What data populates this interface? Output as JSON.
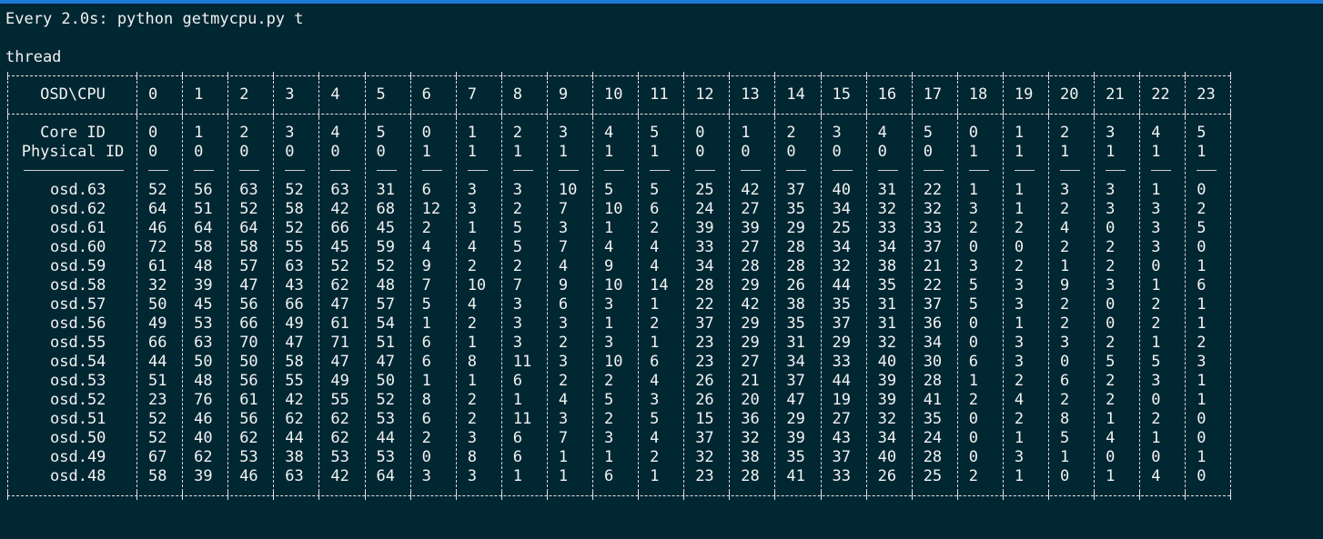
{
  "command_line": "Every 2.0s: python getmycpu.py t",
  "section_label": "thread",
  "table": {
    "corner_header": "OSD\\CPU",
    "cpu_columns": [
      "0",
      "1",
      "2",
      "3",
      "4",
      "5",
      "6",
      "7",
      "8",
      "9",
      "10",
      "11",
      "12",
      "13",
      "14",
      "15",
      "16",
      "17",
      "18",
      "19",
      "20",
      "21",
      "22",
      "23"
    ],
    "core_id_label": "Core ID",
    "core_ids": [
      "0",
      "1",
      "2",
      "3",
      "4",
      "5",
      "0",
      "1",
      "2",
      "3",
      "4",
      "5",
      "0",
      "1",
      "2",
      "3",
      "4",
      "5",
      "0",
      "1",
      "2",
      "3",
      "4",
      "5"
    ],
    "physical_id_label": "Physical ID",
    "physical_ids": [
      "0",
      "0",
      "0",
      "0",
      "0",
      "0",
      "1",
      "1",
      "1",
      "1",
      "1",
      "1",
      "0",
      "0",
      "0",
      "0",
      "0",
      "0",
      "1",
      "1",
      "1",
      "1",
      "1",
      "1"
    ],
    "rows": [
      {
        "osd": "osd.63",
        "values": [
          "52",
          "56",
          "63",
          "52",
          "63",
          "31",
          "6",
          "3",
          "3",
          "10",
          "5",
          "5",
          "25",
          "42",
          "37",
          "40",
          "31",
          "22",
          "1",
          "1",
          "3",
          "3",
          "1",
          "0"
        ]
      },
      {
        "osd": "osd.62",
        "values": [
          "64",
          "51",
          "52",
          "58",
          "42",
          "68",
          "12",
          "3",
          "2",
          "7",
          "10",
          "6",
          "24",
          "27",
          "35",
          "34",
          "32",
          "32",
          "3",
          "1",
          "2",
          "3",
          "3",
          "2"
        ]
      },
      {
        "osd": "osd.61",
        "values": [
          "46",
          "64",
          "64",
          "52",
          "66",
          "45",
          "2",
          "1",
          "5",
          "3",
          "1",
          "2",
          "39",
          "39",
          "29",
          "25",
          "33",
          "33",
          "2",
          "2",
          "4",
          "0",
          "3",
          "5"
        ]
      },
      {
        "osd": "osd.60",
        "values": [
          "72",
          "58",
          "58",
          "55",
          "45",
          "59",
          "4",
          "4",
          "5",
          "7",
          "4",
          "4",
          "33",
          "27",
          "28",
          "34",
          "34",
          "37",
          "0",
          "0",
          "2",
          "2",
          "3",
          "0"
        ]
      },
      {
        "osd": "osd.59",
        "values": [
          "61",
          "48",
          "57",
          "63",
          "52",
          "52",
          "9",
          "2",
          "2",
          "4",
          "9",
          "4",
          "34",
          "28",
          "28",
          "32",
          "38",
          "21",
          "3",
          "2",
          "1",
          "2",
          "0",
          "1"
        ]
      },
      {
        "osd": "osd.58",
        "values": [
          "32",
          "39",
          "47",
          "43",
          "62",
          "48",
          "7",
          "10",
          "7",
          "9",
          "10",
          "14",
          "28",
          "29",
          "26",
          "44",
          "35",
          "22",
          "5",
          "3",
          "9",
          "3",
          "1",
          "6"
        ]
      },
      {
        "osd": "osd.57",
        "values": [
          "50",
          "45",
          "56",
          "66",
          "47",
          "57",
          "5",
          "4",
          "3",
          "6",
          "3",
          "1",
          "22",
          "42",
          "38",
          "35",
          "31",
          "37",
          "5",
          "3",
          "2",
          "0",
          "2",
          "1"
        ]
      },
      {
        "osd": "osd.56",
        "values": [
          "49",
          "53",
          "66",
          "49",
          "61",
          "54",
          "1",
          "2",
          "3",
          "3",
          "1",
          "2",
          "37",
          "29",
          "35",
          "37",
          "31",
          "36",
          "0",
          "1",
          "2",
          "0",
          "2",
          "1"
        ]
      },
      {
        "osd": "osd.55",
        "values": [
          "66",
          "63",
          "70",
          "47",
          "71",
          "51",
          "6",
          "1",
          "3",
          "2",
          "3",
          "1",
          "23",
          "29",
          "31",
          "29",
          "32",
          "34",
          "0",
          "3",
          "3",
          "2",
          "1",
          "2"
        ]
      },
      {
        "osd": "osd.54",
        "values": [
          "44",
          "50",
          "50",
          "58",
          "47",
          "47",
          "6",
          "8",
          "11",
          "3",
          "10",
          "6",
          "23",
          "27",
          "34",
          "33",
          "40",
          "30",
          "6",
          "3",
          "0",
          "5",
          "5",
          "3"
        ]
      },
      {
        "osd": "osd.53",
        "values": [
          "51",
          "48",
          "56",
          "55",
          "49",
          "50",
          "1",
          "1",
          "6",
          "2",
          "2",
          "4",
          "26",
          "21",
          "37",
          "44",
          "39",
          "28",
          "1",
          "2",
          "6",
          "2",
          "3",
          "1"
        ]
      },
      {
        "osd": "osd.52",
        "values": [
          "23",
          "76",
          "61",
          "42",
          "55",
          "52",
          "8",
          "2",
          "1",
          "4",
          "5",
          "3",
          "26",
          "20",
          "47",
          "19",
          "39",
          "41",
          "2",
          "4",
          "2",
          "2",
          "0",
          "1"
        ]
      },
      {
        "osd": "osd.51",
        "values": [
          "52",
          "46",
          "56",
          "62",
          "62",
          "53",
          "6",
          "2",
          "11",
          "3",
          "2",
          "5",
          "15",
          "36",
          "29",
          "27",
          "32",
          "35",
          "0",
          "2",
          "8",
          "1",
          "2",
          "0"
        ]
      },
      {
        "osd": "osd.50",
        "values": [
          "52",
          "40",
          "62",
          "44",
          "62",
          "44",
          "2",
          "3",
          "6",
          "7",
          "3",
          "4",
          "37",
          "32",
          "39",
          "43",
          "34",
          "24",
          "0",
          "1",
          "5",
          "4",
          "1",
          "0"
        ]
      },
      {
        "osd": "osd.49",
        "values": [
          "67",
          "62",
          "53",
          "38",
          "53",
          "53",
          "0",
          "8",
          "6",
          "1",
          "1",
          "2",
          "32",
          "38",
          "35",
          "37",
          "40",
          "28",
          "0",
          "3",
          "1",
          "0",
          "0",
          "1"
        ]
      },
      {
        "osd": "osd.48",
        "values": [
          "58",
          "39",
          "46",
          "63",
          "42",
          "64",
          "3",
          "3",
          "1",
          "1",
          "6",
          "1",
          "23",
          "28",
          "41",
          "33",
          "26",
          "25",
          "2",
          "1",
          "0",
          "1",
          "4",
          "0"
        ]
      }
    ]
  },
  "colors": {
    "background": "#012733",
    "text": "#f2f2f2",
    "title_accent": "#1d7bd6"
  }
}
